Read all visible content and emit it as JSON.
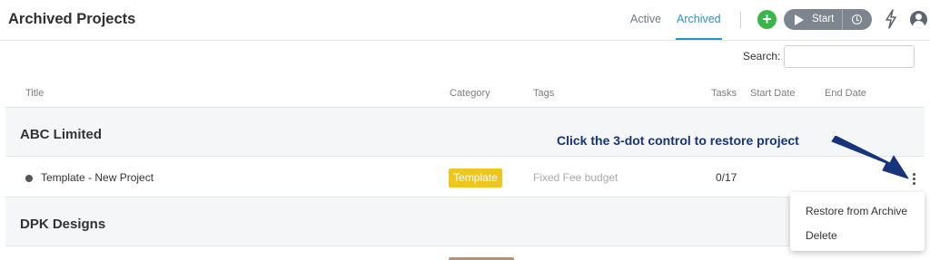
{
  "header": {
    "title": "Archived Projects",
    "tabs": [
      {
        "label": "Active"
      },
      {
        "label": "Archived"
      }
    ],
    "start_label": "Start"
  },
  "search": {
    "label": "Search:",
    "value": ""
  },
  "table": {
    "columns": [
      "Title",
      "Category",
      "Tags",
      "Tasks",
      "Start Date",
      "End Date"
    ],
    "groups": [
      {
        "name": "ABC Limited",
        "projects": [
          {
            "title": "Template - New Project",
            "category": "Template",
            "tags": "Fixed Fee budget",
            "tasks": "0/17",
            "start_date": "",
            "end_date": ""
          }
        ]
      },
      {
        "name": "DPK Designs",
        "projects": []
      }
    ]
  },
  "annotation": {
    "text": "Click the 3-dot control to restore project"
  },
  "context_menu": {
    "items": [
      "Restore from Archive",
      "Delete"
    ]
  },
  "colors": {
    "accent": "#2a93c7",
    "add_button": "#39b54a",
    "template_badge": "#efc61f",
    "annotation": "#17337e",
    "group_background": "#f5f6f8"
  },
  "icons": [
    "plus-icon",
    "play-icon",
    "clock-icon",
    "bolt-icon",
    "user-icon",
    "more-vertical-icon"
  ]
}
